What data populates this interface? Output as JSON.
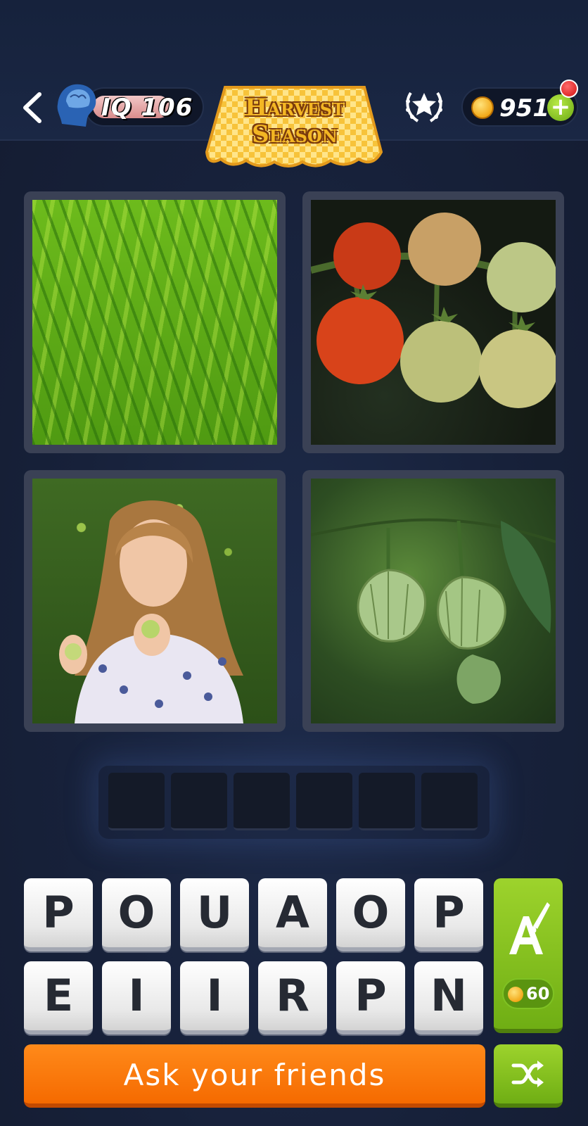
{
  "header": {
    "back_icon": "chevron-left-icon",
    "iq_label": "IQ 106",
    "event_banner_line1": "Harvest",
    "event_banner_line2": "Season",
    "achievements_icon": "laurel-star-icon",
    "coins": "951",
    "add_coins_icon": "plus-icon",
    "notification_dot_color": "#e01717"
  },
  "puzzle": {
    "pictures": [
      {
        "subject": "green-bananas-image"
      },
      {
        "subject": "tomatoes-on-vine-image"
      },
      {
        "subject": "girl-eating-sour-fruit-image"
      },
      {
        "subject": "physalis-husks-image"
      }
    ],
    "answer_length": 6
  },
  "keyboard": {
    "row1": [
      "P",
      "O",
      "U",
      "A",
      "O",
      "P"
    ],
    "row2": [
      "E",
      "I",
      "I",
      "R",
      "P",
      "N"
    ],
    "hint_cost": "60",
    "hint_icon": "letter-brush-icon",
    "shuffle_icon": "shuffle-icon"
  },
  "actions": {
    "ask_label": "Ask your friends"
  },
  "colors": {
    "accent_orange": "#f56a00",
    "accent_green": "#7fc223",
    "background": "#17213a"
  }
}
